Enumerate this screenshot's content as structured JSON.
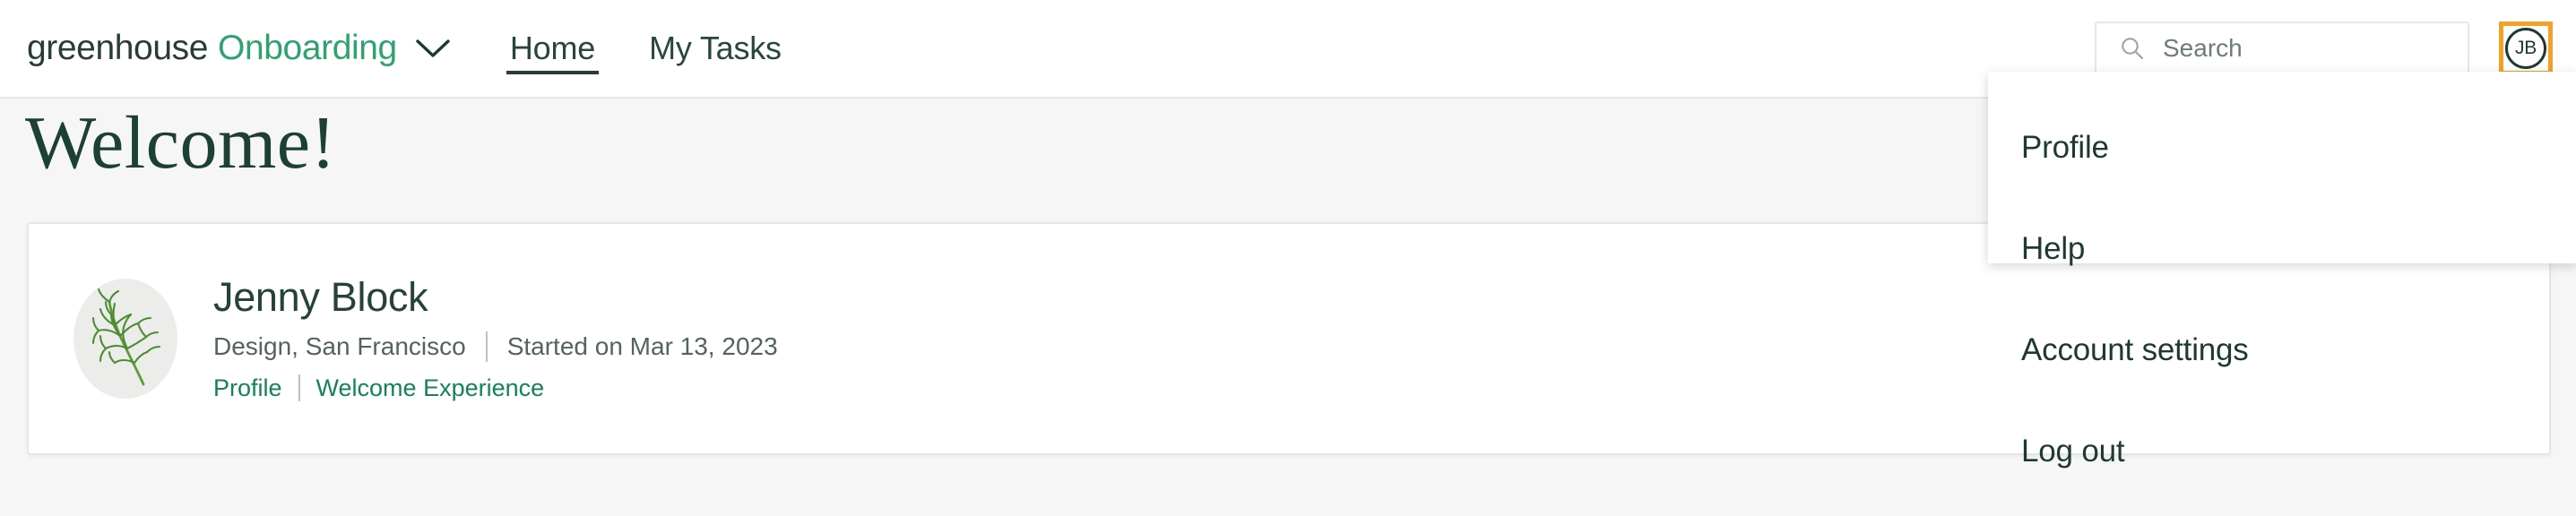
{
  "header": {
    "brand": {
      "name": "greenhouse",
      "product": "Onboarding",
      "chevron_icon": "chevron-down-icon"
    },
    "tabs": [
      {
        "label": "Home",
        "active": true
      },
      {
        "label": "My Tasks",
        "active": false
      }
    ],
    "search": {
      "placeholder": "Search",
      "value": "",
      "icon": "search-icon"
    },
    "avatar": {
      "initials": "JB",
      "focused": true,
      "focus_ring_color": "#f5a028"
    }
  },
  "page": {
    "title": "Welcome!"
  },
  "profile_card": {
    "avatar_image": "plant-sprig-illustration",
    "name": "Jenny Block",
    "department_location": "Design, San Francisco",
    "start_date": "Started on Mar 13, 2023",
    "links": [
      {
        "label": "Profile"
      },
      {
        "label": "Welcome Experience"
      }
    ]
  },
  "account_menu": {
    "open": true,
    "items": [
      {
        "label": "Profile"
      },
      {
        "label": "Help"
      },
      {
        "label": "Account settings"
      },
      {
        "label": "Log out"
      }
    ]
  },
  "colors": {
    "brand_green": "#2fa36f",
    "dark_green": "#283d35",
    "link_green": "#14825a",
    "accent_orange": "#f5a028",
    "page_background": "#f6f6f6",
    "border": "#e3e7e6"
  }
}
